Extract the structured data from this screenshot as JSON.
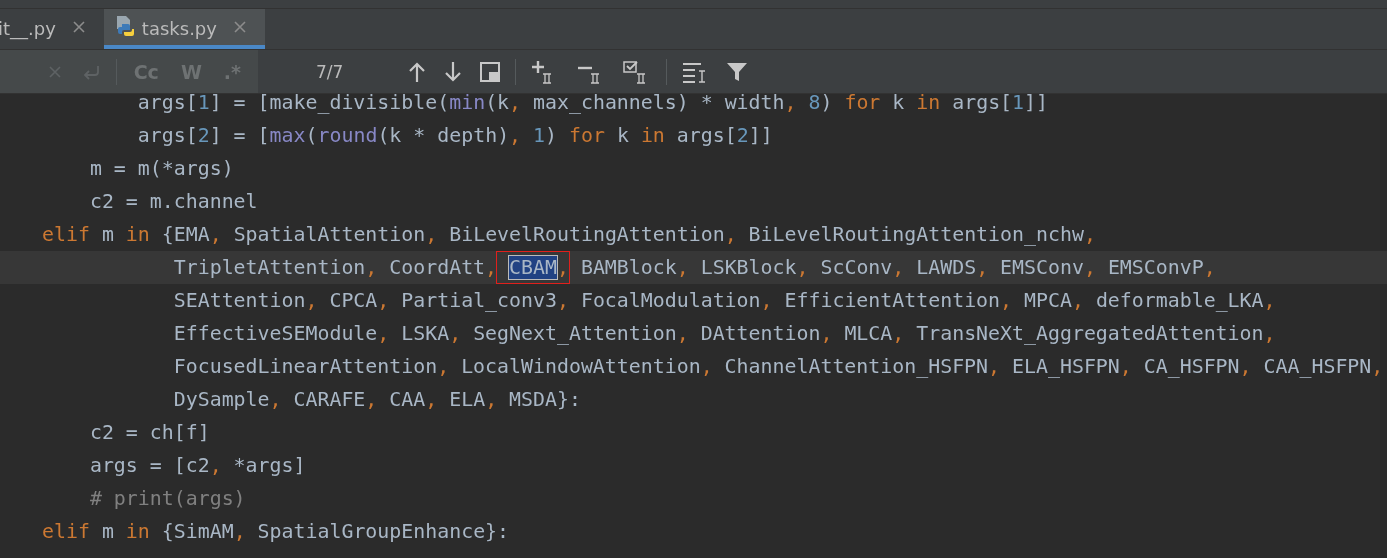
{
  "tabs": [
    {
      "label": "it__.py",
      "selected": false,
      "kind": "plain"
    },
    {
      "label": "tasks.py",
      "selected": true,
      "kind": "file-icon"
    }
  ],
  "search_bar": {
    "options": [
      {
        "label": "Cc",
        "selected": false
      },
      {
        "label": "W",
        "selected": false
      },
      {
        "label": ".*",
        "selected": false
      }
    ],
    "match_count": "7/7"
  },
  "code_lines": [
    {
      "current": false,
      "tokens": [
        {
          "kind": "plain",
          "text": "        args["
        },
        {
          "kind": "number",
          "text": "1"
        },
        {
          "kind": "plain",
          "text": "] = [make_divisible("
        },
        {
          "kind": "builtin",
          "text": "min"
        },
        {
          "kind": "plain",
          "text": "(k"
        },
        {
          "kind": "comma",
          "text": ", "
        },
        {
          "kind": "plain",
          "text": "max_channels) * width"
        },
        {
          "kind": "comma",
          "text": ", "
        },
        {
          "kind": "number",
          "text": "8"
        },
        {
          "kind": "plain",
          "text": ") "
        },
        {
          "kind": "keyword",
          "text": "for"
        },
        {
          "kind": "plain",
          "text": " k "
        },
        {
          "kind": "keyword",
          "text": "in"
        },
        {
          "kind": "plain",
          "text": " args["
        },
        {
          "kind": "number",
          "text": "1"
        },
        {
          "kind": "plain",
          "text": "]]"
        }
      ]
    },
    {
      "current": false,
      "tokens": [
        {
          "kind": "plain",
          "text": "        args["
        },
        {
          "kind": "number",
          "text": "2"
        },
        {
          "kind": "plain",
          "text": "] = ["
        },
        {
          "kind": "builtin",
          "text": "max"
        },
        {
          "kind": "plain",
          "text": "("
        },
        {
          "kind": "builtin",
          "text": "round"
        },
        {
          "kind": "plain",
          "text": "(k * depth)"
        },
        {
          "kind": "comma",
          "text": ", "
        },
        {
          "kind": "number",
          "text": "1"
        },
        {
          "kind": "plain",
          "text": ") "
        },
        {
          "kind": "keyword",
          "text": "for"
        },
        {
          "kind": "plain",
          "text": " k "
        },
        {
          "kind": "keyword",
          "text": "in"
        },
        {
          "kind": "plain",
          "text": " args["
        },
        {
          "kind": "number",
          "text": "2"
        },
        {
          "kind": "plain",
          "text": "]]"
        }
      ]
    },
    {
      "current": false,
      "tokens": [
        {
          "kind": "plain",
          "text": "    m = m(*args)"
        }
      ]
    },
    {
      "current": false,
      "tokens": [
        {
          "kind": "plain",
          "text": "    c2 = m.channel"
        }
      ]
    },
    {
      "current": false,
      "tokens": [
        {
          "kind": "keyword",
          "text": "elif"
        },
        {
          "kind": "plain",
          "text": " m "
        },
        {
          "kind": "keyword",
          "text": "in"
        },
        {
          "kind": "plain",
          "text": " {EMA"
        },
        {
          "kind": "comma",
          "text": ", "
        },
        {
          "kind": "plain",
          "text": "SpatialAttention"
        },
        {
          "kind": "comma",
          "text": ", "
        },
        {
          "kind": "plain",
          "text": "BiLevelRoutingAttention"
        },
        {
          "kind": "comma",
          "text": ", "
        },
        {
          "kind": "plain",
          "text": "BiLevelRoutingAttention_nchw"
        },
        {
          "kind": "comma",
          "text": ","
        }
      ]
    },
    {
      "current": true,
      "tokens": [
        {
          "kind": "plain",
          "text": "           TripletAttention"
        },
        {
          "kind": "comma",
          "text": ", "
        },
        {
          "kind": "plain",
          "text": "CoordAtt"
        },
        {
          "kind": "comma",
          "text": ", "
        },
        {
          "kind": "match",
          "text": "CBAM",
          "framed": true
        },
        {
          "kind": "comma",
          "text": ", "
        },
        {
          "kind": "plain",
          "text": "BAMBlock"
        },
        {
          "kind": "comma",
          "text": ", "
        },
        {
          "kind": "plain",
          "text": "LSKBlock"
        },
        {
          "kind": "comma",
          "text": ", "
        },
        {
          "kind": "plain",
          "text": "ScConv"
        },
        {
          "kind": "comma",
          "text": ", "
        },
        {
          "kind": "plain",
          "text": "LAWDS"
        },
        {
          "kind": "comma",
          "text": ", "
        },
        {
          "kind": "plain",
          "text": "EMSConv"
        },
        {
          "kind": "comma",
          "text": ", "
        },
        {
          "kind": "plain",
          "text": "EMSConvP"
        },
        {
          "kind": "comma",
          "text": ","
        }
      ]
    },
    {
      "current": false,
      "tokens": [
        {
          "kind": "plain",
          "text": "           SEAttention"
        },
        {
          "kind": "comma",
          "text": ", "
        },
        {
          "kind": "plain",
          "text": "CPCA"
        },
        {
          "kind": "comma",
          "text": ", "
        },
        {
          "kind": "plain",
          "text": "Partial_conv3"
        },
        {
          "kind": "comma",
          "text": ", "
        },
        {
          "kind": "plain",
          "text": "FocalModulation"
        },
        {
          "kind": "comma",
          "text": ", "
        },
        {
          "kind": "plain",
          "text": "EfficientAttention"
        },
        {
          "kind": "comma",
          "text": ", "
        },
        {
          "kind": "plain",
          "text": "MPCA"
        },
        {
          "kind": "comma",
          "text": ", "
        },
        {
          "kind": "plain",
          "text": "deformable_LKA"
        },
        {
          "kind": "comma",
          "text": ","
        }
      ]
    },
    {
      "current": false,
      "tokens": [
        {
          "kind": "plain",
          "text": "           EffectiveSEModule"
        },
        {
          "kind": "comma",
          "text": ", "
        },
        {
          "kind": "plain",
          "text": "LSKA"
        },
        {
          "kind": "comma",
          "text": ", "
        },
        {
          "kind": "plain",
          "text": "SegNext_Attention"
        },
        {
          "kind": "comma",
          "text": ", "
        },
        {
          "kind": "plain",
          "text": "DAttention"
        },
        {
          "kind": "comma",
          "text": ", "
        },
        {
          "kind": "plain",
          "text": "MLCA"
        },
        {
          "kind": "comma",
          "text": ", "
        },
        {
          "kind": "plain",
          "text": "TransNeXt_AggregatedAttention"
        },
        {
          "kind": "comma",
          "text": ","
        }
      ]
    },
    {
      "current": false,
      "tokens": [
        {
          "kind": "plain",
          "text": "           FocusedLinearAttention"
        },
        {
          "kind": "comma",
          "text": ", "
        },
        {
          "kind": "plain",
          "text": "LocalWindowAttention"
        },
        {
          "kind": "comma",
          "text": ", "
        },
        {
          "kind": "plain",
          "text": "ChannelAttention_HSFPN"
        },
        {
          "kind": "comma",
          "text": ", "
        },
        {
          "kind": "plain",
          "text": "ELA_HSFPN"
        },
        {
          "kind": "comma",
          "text": ", "
        },
        {
          "kind": "plain",
          "text": "CA_HSFPN"
        },
        {
          "kind": "comma",
          "text": ", "
        },
        {
          "kind": "plain",
          "text": "CAA_HSFPN"
        },
        {
          "kind": "comma",
          "text": ","
        }
      ]
    },
    {
      "current": false,
      "tokens": [
        {
          "kind": "plain",
          "text": "           DySample"
        },
        {
          "kind": "comma",
          "text": ", "
        },
        {
          "kind": "plain",
          "text": "CARAFE"
        },
        {
          "kind": "comma",
          "text": ", "
        },
        {
          "kind": "plain",
          "text": "CAA"
        },
        {
          "kind": "comma",
          "text": ", "
        },
        {
          "kind": "plain",
          "text": "ELA"
        },
        {
          "kind": "comma",
          "text": ", "
        },
        {
          "kind": "plain",
          "text": "MSDA}:"
        }
      ]
    },
    {
      "current": false,
      "tokens": [
        {
          "kind": "plain",
          "text": "    c2 = ch[f]"
        }
      ]
    },
    {
      "current": false,
      "tokens": [
        {
          "kind": "plain",
          "text": "    args = [c2"
        },
        {
          "kind": "comma",
          "text": ", "
        },
        {
          "kind": "plain",
          "text": "*args]"
        }
      ]
    },
    {
      "current": false,
      "tokens": [
        {
          "kind": "comment",
          "text": "    # print(args)"
        }
      ]
    },
    {
      "current": false,
      "tokens": [
        {
          "kind": "keyword",
          "text": "elif"
        },
        {
          "kind": "plain",
          "text": " m "
        },
        {
          "kind": "keyword",
          "text": "in"
        },
        {
          "kind": "plain",
          "text": " {SimAM"
        },
        {
          "kind": "comma",
          "text": ", "
        },
        {
          "kind": "plain",
          "text": "SpatialGroupEnhance}:"
        }
      ]
    }
  ]
}
